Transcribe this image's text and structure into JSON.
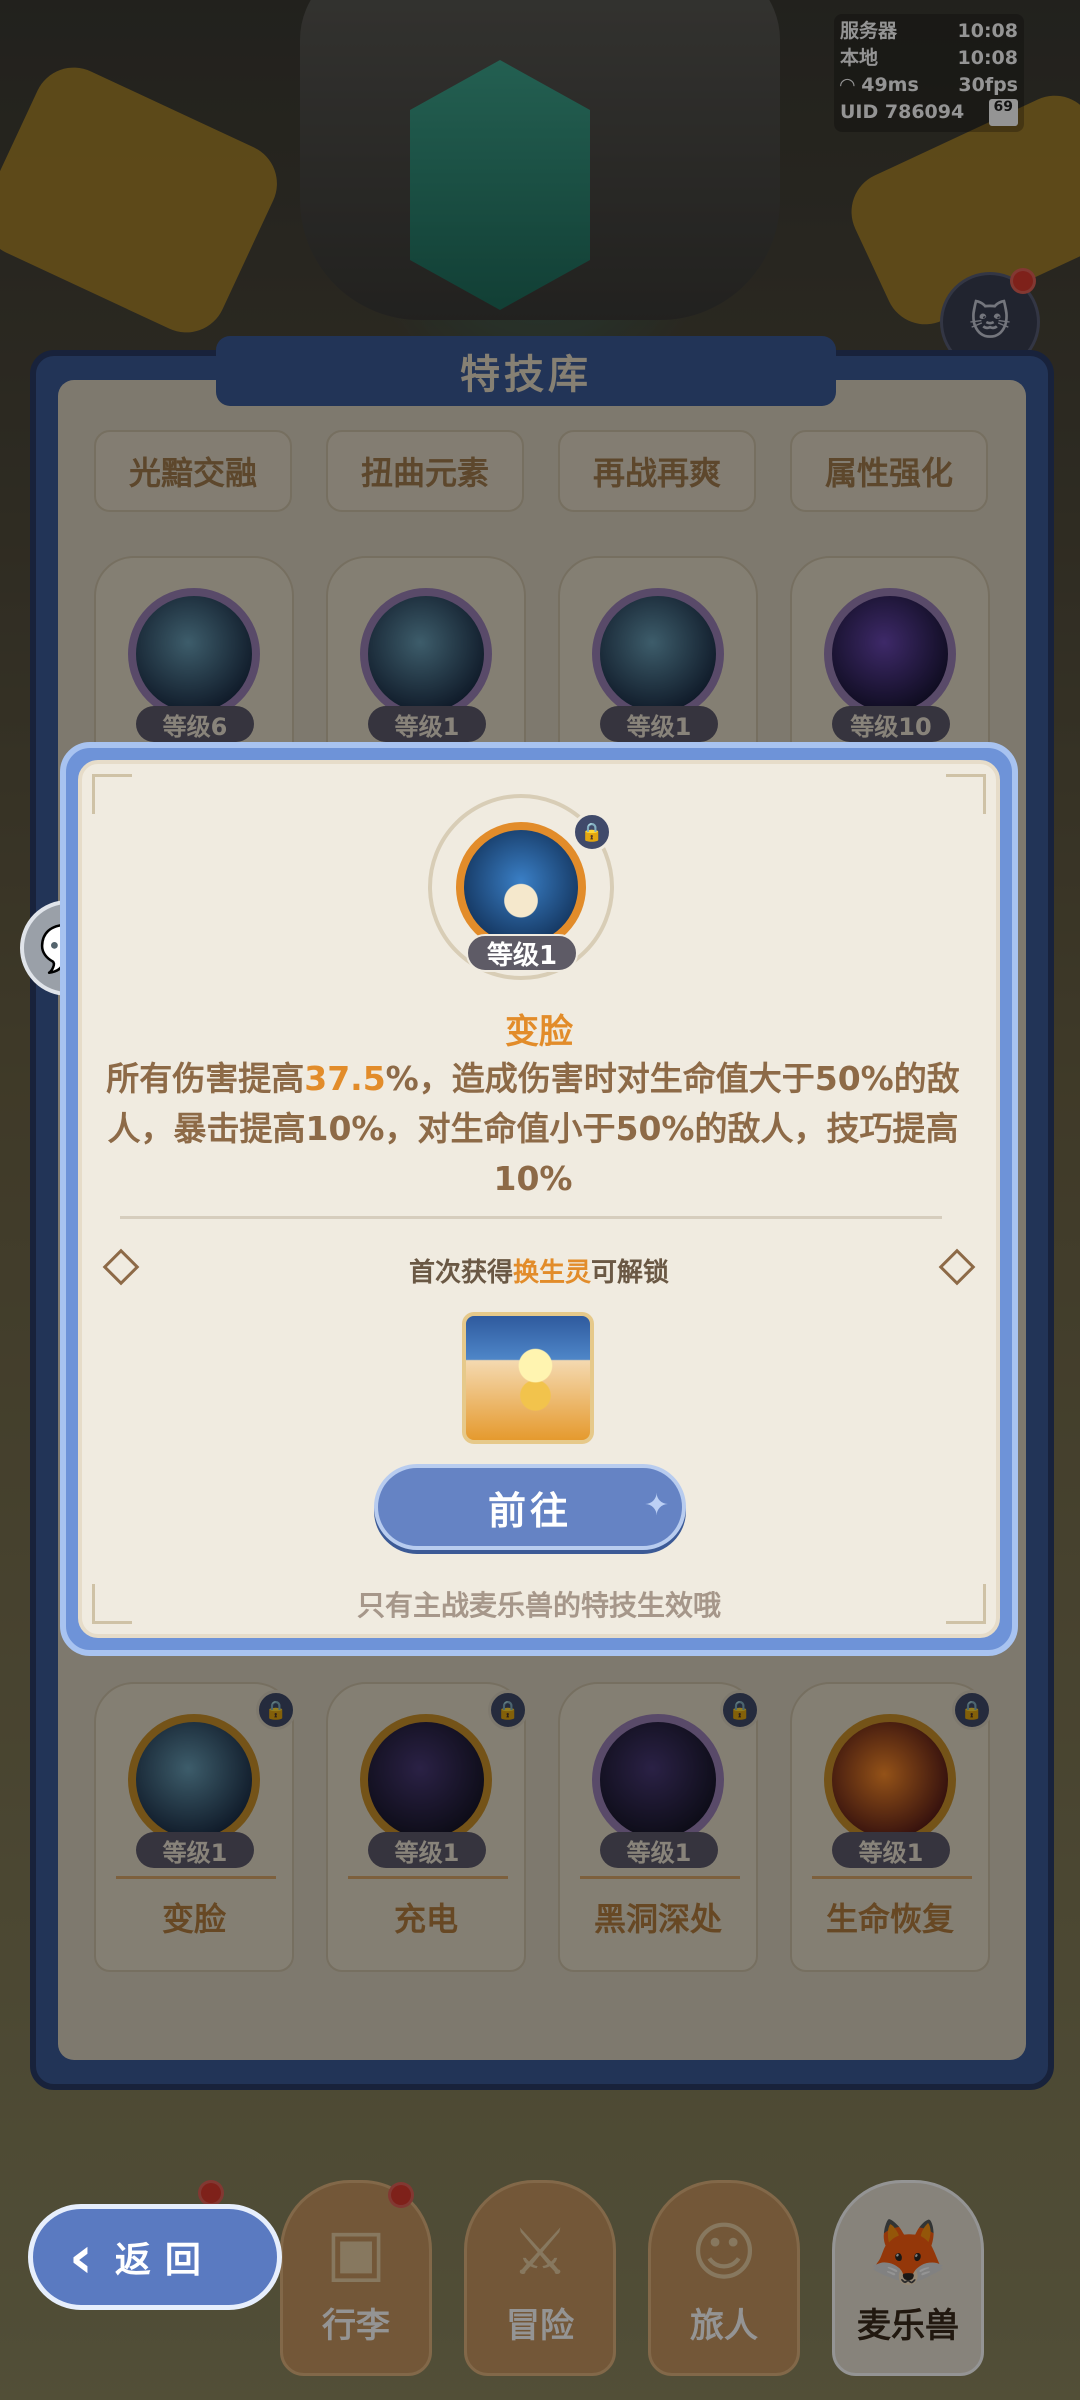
{
  "hud": {
    "server_label": "服务器",
    "server_time": "10:08",
    "local_label": "本地",
    "local_time": "10:08",
    "ping": "49ms",
    "fps": "30fps",
    "uid": "UID 786094",
    "battery": "69"
  },
  "library": {
    "title": "特技库",
    "filters": [
      "光黯交融",
      "扭曲元素",
      "再战再爽",
      "属性强化"
    ],
    "top_row_levels": [
      "等级6",
      "等级1",
      "等级1",
      "等级10"
    ],
    "bottom_row": [
      {
        "level": "等级1",
        "name": "变脸"
      },
      {
        "level": "等级1",
        "name": "充电"
      },
      {
        "level": "等级1",
        "name": "黑洞深处"
      },
      {
        "level": "等级1",
        "name": "生命恢复"
      }
    ]
  },
  "modal": {
    "level": "等级1",
    "title": "变脸",
    "desc_part1": "所有伤害提高",
    "desc_highlight": "37.5",
    "desc_part2": "%，造成伤害时对生命值大于50%的敌人，暴击提高10%，对生命值小于50%的敌人，技巧提高10%",
    "unlock_prefix": "首次获得",
    "unlock_item": "换生灵",
    "unlock_suffix": "可解锁",
    "goto_label": "前往",
    "footnote": "只有主战麦乐兽的特技生效哦"
  },
  "nav": {
    "back_label": "返回",
    "items": [
      "行李",
      "冒险",
      "旅人",
      "麦乐兽"
    ]
  },
  "colors": {
    "accent_orange": "#e28c2a",
    "panel_blue": "#3c5a96",
    "modal_blue": "#6e93d8",
    "text_brown": "#8d6a47"
  }
}
